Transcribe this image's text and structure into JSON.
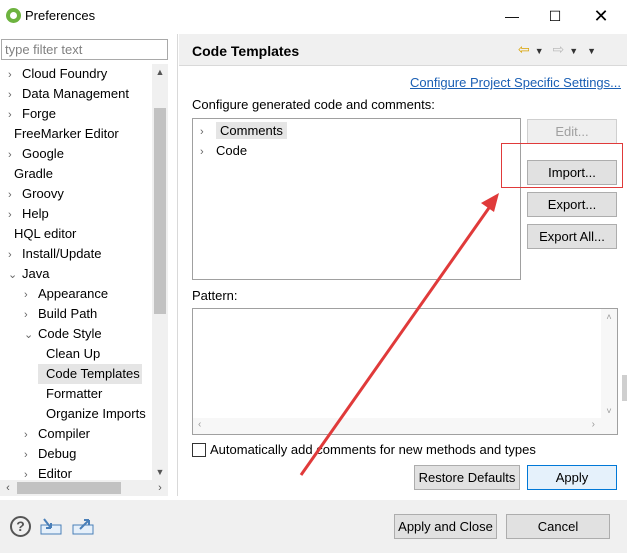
{
  "window": {
    "title": "Preferences",
    "minimize": "—",
    "maximize": "☐",
    "close": "✕"
  },
  "filter": {
    "placeholder": "type filter text"
  },
  "tree": {
    "items": [
      {
        "label": "Cloud Foundry",
        "arrow": "›",
        "level": 0
      },
      {
        "label": "Data Management",
        "arrow": "›",
        "level": 0
      },
      {
        "label": "Forge",
        "arrow": "›",
        "level": 0
      },
      {
        "label": "FreeMarker Editor",
        "arrow": "",
        "level": 0
      },
      {
        "label": "Google",
        "arrow": "›",
        "level": 0
      },
      {
        "label": "Gradle",
        "arrow": "",
        "level": 0
      },
      {
        "label": "Groovy",
        "arrow": "›",
        "level": 0
      },
      {
        "label": "Help",
        "arrow": "›",
        "level": 0
      },
      {
        "label": "HQL editor",
        "arrow": "",
        "level": 0
      },
      {
        "label": "Install/Update",
        "arrow": "›",
        "level": 0
      },
      {
        "label": "Java",
        "arrow": "⌄",
        "level": 0
      },
      {
        "label": "Appearance",
        "arrow": "›",
        "level": 1
      },
      {
        "label": "Build Path",
        "arrow": "›",
        "level": 1
      },
      {
        "label": "Code Style",
        "arrow": "⌄",
        "level": 1
      },
      {
        "label": "Clean Up",
        "arrow": "",
        "level": 2
      },
      {
        "label": "Code Templates",
        "arrow": "",
        "level": 2,
        "selected": true
      },
      {
        "label": "Formatter",
        "arrow": "",
        "level": 2
      },
      {
        "label": "Organize Imports",
        "arrow": "",
        "level": 2
      },
      {
        "label": "Compiler",
        "arrow": "›",
        "level": 1
      },
      {
        "label": "Debug",
        "arrow": "›",
        "level": 1
      },
      {
        "label": "Editor",
        "arrow": "›",
        "level": 1
      }
    ]
  },
  "page": {
    "title": "Code Templates",
    "link": "Configure Project Specific Settings...",
    "section_label": "Configure generated code and comments:",
    "templates": [
      {
        "label": "Comments",
        "selected": true
      },
      {
        "label": "Code",
        "selected": false
      }
    ],
    "buttons": {
      "edit": "Edit...",
      "import": "Import...",
      "export": "Export...",
      "export_all": "Export All..."
    },
    "pattern_label": "Pattern:",
    "auto_comments": "Automatically add comments for new methods and types",
    "restore_defaults": "Restore Defaults",
    "apply": "Apply"
  },
  "footer": {
    "apply_close": "Apply and Close",
    "cancel": "Cancel",
    "help": "?"
  },
  "colors": {
    "annotation": "#e03a3a",
    "link": "#1a5fb4",
    "spring": "#6db33f"
  }
}
